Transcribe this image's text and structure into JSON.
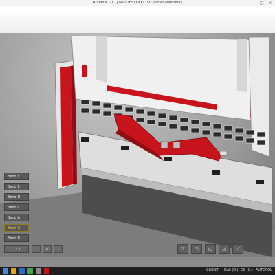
{
  "window": {
    "title": "AutoPOL GT - [1400TESTXXX1150: carter-anterieur]"
  },
  "bends": [
    {
      "label": "Bend F",
      "active": false
    },
    {
      "label": "Bend E",
      "active": false
    },
    {
      "label": "Bend D",
      "active": false
    },
    {
      "label": "Bend C",
      "active": false
    },
    {
      "label": "Bend A",
      "active": false
    },
    {
      "label": "Bend G",
      "active": true
    },
    {
      "label": "Bend B",
      "active": false
    }
  ],
  "pager": {
    "text": "7 / 7"
  },
  "taskbar": {
    "tray": [
      "CLIENT",
      "Dali (D:)",
      "OS (C:)",
      "AUTOPOL"
    ]
  },
  "colors": {
    "accent_red": "#c8141c",
    "bend_active": "#e5c235",
    "machine_white": "#eeeeee"
  },
  "icons": [
    "minimize-icon",
    "maximize-icon",
    "close-icon",
    "windows-start-icon"
  ]
}
